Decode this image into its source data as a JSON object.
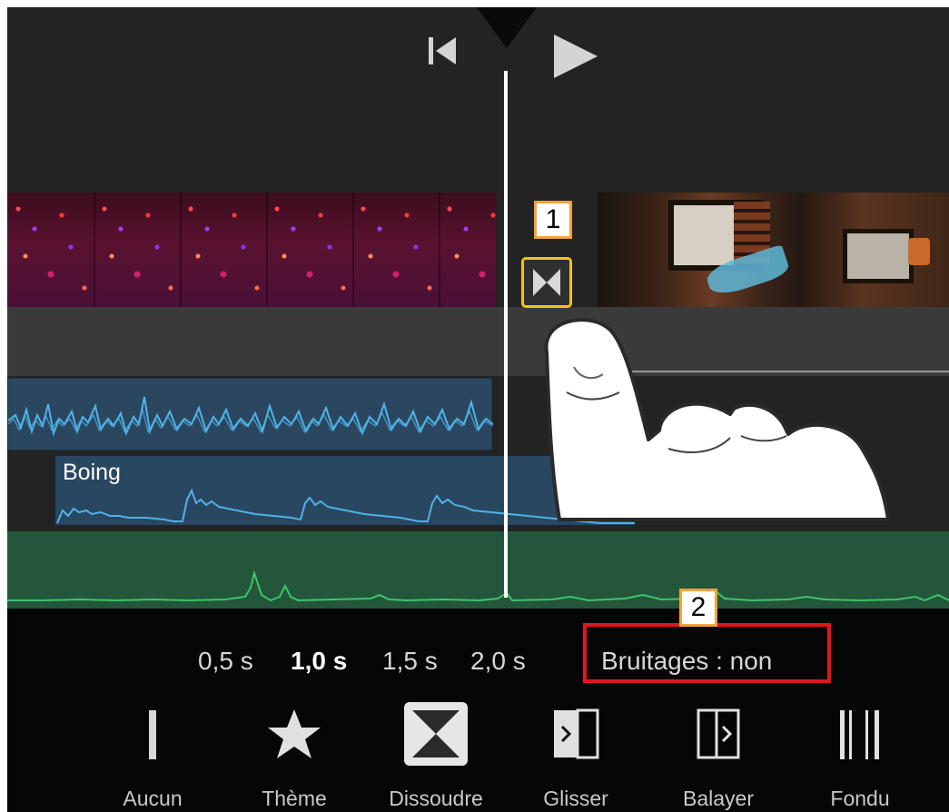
{
  "viewer": {
    "skip_back_icon": "skip-to-start-icon",
    "play_icon": "play-icon"
  },
  "timeline": {
    "audio_clip_label": "Boing",
    "transition_icon": "dissolve-transition-icon"
  },
  "callouts": [
    "1",
    "2"
  ],
  "durations": [
    {
      "label": "0,5 s",
      "selected": false
    },
    {
      "label": "1,0 s",
      "selected": true
    },
    {
      "label": "1,5 s",
      "selected": false
    },
    {
      "label": "2,0 s",
      "selected": false
    }
  ],
  "sound_effects": {
    "label": "Bruitages : non"
  },
  "transitions": [
    {
      "label": "Aucun",
      "icon": "none-icon"
    },
    {
      "label": "Thème",
      "icon": "star-icon"
    },
    {
      "label": "Dissoudre",
      "icon": "dissolve-icon",
      "selected": true
    },
    {
      "label": "Glisser",
      "icon": "slide-icon"
    },
    {
      "label": "Balayer",
      "icon": "wipe-icon"
    },
    {
      "label": "Fondu",
      "icon": "fade-icon"
    }
  ],
  "colors": {
    "highlight_yellow": "#f0c419",
    "callout_border": "#f4a23c",
    "annotation_red": "#e3141d",
    "music_track": "#2b4760",
    "voice_track": "#23563a",
    "waveform_blue": "#4fb3e8",
    "waveform_green": "#3ec66a"
  }
}
